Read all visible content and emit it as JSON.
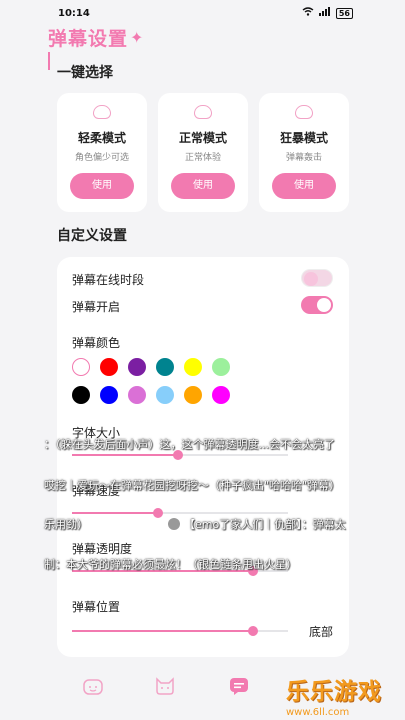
{
  "status": {
    "time": "10:14",
    "battery": "56"
  },
  "page_title": "弹幕设置",
  "quick": {
    "section_title": "一键选择",
    "modes": [
      {
        "name": "轻柔模式",
        "desc": "角色偏少可选",
        "button": "使用"
      },
      {
        "name": "正常模式",
        "desc": "正常体验",
        "button": "使用"
      },
      {
        "name": "狂暴模式",
        "desc": "弹幕轰击",
        "button": "使用"
      }
    ]
  },
  "custom": {
    "section_title": "自定义设置",
    "online_label": "弹幕在线时段",
    "online_on": false,
    "enable_label": "弹幕开启",
    "enable_on": true,
    "color_label": "弹幕颜色",
    "colors": [
      "#ffffff",
      "#ff0000",
      "#7b1fa2",
      "#00838f",
      "#ffff00",
      "#9cf09c",
      "#000000",
      "#0000ff",
      "#da70d6",
      "#87cefa",
      "#ffa500",
      "#ff00ff"
    ],
    "font_label": "字体大小",
    "font_value": 0.49,
    "speed_label": "弹幕速度",
    "speed_value": 0.4,
    "opacity_label": "弹幕透明度",
    "opacity_value": 0.84,
    "position_label": "弹幕位置",
    "position_value": 0.84,
    "position_text": "底部"
  },
  "danmaku": [
    "：（躲在头发后面小声）这，这个弹幕透明度...会不会太亮了",
    "哎挖｜爱玩～在弹幕花园挖呀挖～（种子疯出\"哈哈哈\"弹幕）",
    "乐用劲）",
    "【emo了家人们｜仇部】：弹幕太",
    "制：本大爷的弹幕必须最炫！（银色链条甩出火星）"
  ],
  "watermark": {
    "main": "乐乐游戏",
    "sub": "www.6ll.com"
  },
  "colors": {
    "accent": "#f27ab0",
    "card": "#ffffff",
    "bg": "#f4f4f6"
  }
}
